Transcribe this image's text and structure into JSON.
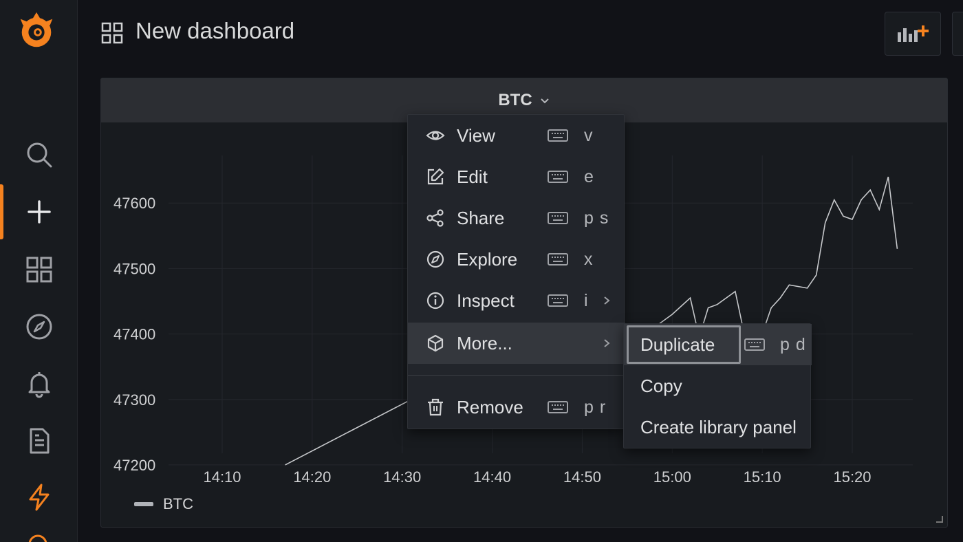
{
  "header": {
    "title": "New dashboard"
  },
  "panel": {
    "title": "BTC",
    "legend": "BTC"
  },
  "chart_data": {
    "type": "line",
    "series": [
      {
        "name": "BTC",
        "x": [
          "14:17",
          "14:31",
          "14:37",
          "14:43",
          "14:49",
          "14:56",
          "14:57",
          "15:00",
          "15:02",
          "15:03",
          "15:04",
          "15:05",
          "15:07",
          "15:08",
          "15:10",
          "15:11",
          "15:12",
          "15:13",
          "15:15",
          "15:16",
          "15:17",
          "15:18",
          "15:19",
          "15:20",
          "15:21",
          "15:22",
          "15:23",
          "15:24",
          "15:25"
        ],
        "y": [
          47200,
          47300,
          47340,
          47360,
          47380,
          47400,
          47400,
          47430,
          47455,
          47395,
          47440,
          47445,
          47465,
          47400,
          47400,
          47440,
          47455,
          47475,
          47470,
          47490,
          47570,
          47605,
          47580,
          47575,
          47605,
          47620,
          47590,
          47640,
          47530
        ]
      }
    ],
    "yticks": [
      "47600",
      "47500",
      "47400",
      "47300",
      "47200"
    ],
    "xticks": [
      "14:10",
      "14:20",
      "14:30",
      "14:40",
      "14:50",
      "15:00",
      "15:10",
      "15:20"
    ],
    "ylim": [
      47160,
      47720
    ]
  },
  "menu": {
    "items": [
      {
        "label": "View",
        "shortcut": "v"
      },
      {
        "label": "Edit",
        "shortcut": "e"
      },
      {
        "label": "Share",
        "shortcut": "p s"
      },
      {
        "label": "Explore",
        "shortcut": "x"
      },
      {
        "label": "Inspect",
        "shortcut": "i"
      },
      {
        "label": "More..."
      },
      {
        "label": "Remove",
        "shortcut": "p r"
      }
    ]
  },
  "submenu": {
    "items": [
      {
        "label": "Duplicate",
        "shortcut": "p d"
      },
      {
        "label": "Copy"
      },
      {
        "label": "Create library panel"
      }
    ]
  },
  "colors": {
    "accent": "#f5821f",
    "series": "#c7c9cc"
  }
}
